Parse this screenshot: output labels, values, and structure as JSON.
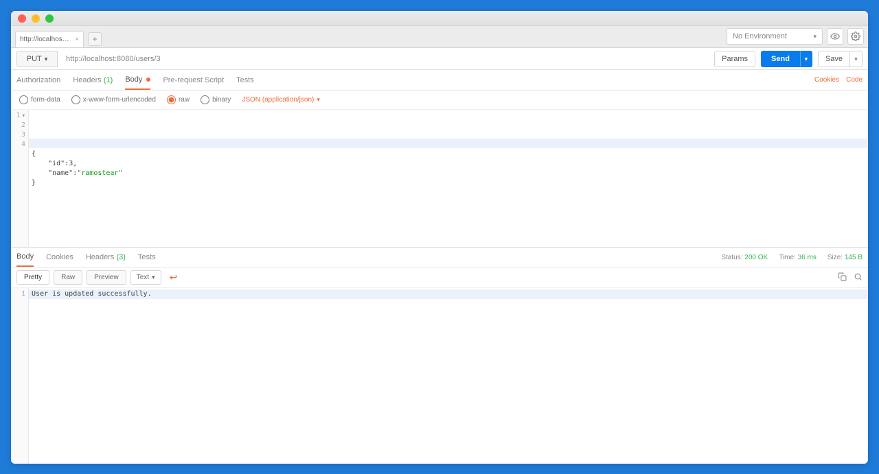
{
  "tabs": {
    "request_tab_label": "http://localhost:8080/"
  },
  "env": {
    "selected": "No Environment"
  },
  "request": {
    "method": "PUT",
    "url": "http://localhost:8080/users/3",
    "buttons": {
      "params": "Params",
      "send": "Send",
      "save": "Save"
    }
  },
  "request_tabs": {
    "authorization": "Authorization",
    "headers": "Headers",
    "headers_count": "(1)",
    "body": "Body",
    "prerequest": "Pre-request Script",
    "tests": "Tests",
    "cookies": "Cookies",
    "code": "Code"
  },
  "body_type": {
    "form_data": "form-data",
    "x_www": "x-www-form-urlencoded",
    "raw": "raw",
    "binary": "binary",
    "content_type": "JSON (application/json)"
  },
  "body_editor": {
    "line1": "{",
    "line2_pre": "    \"id\":",
    "line2_val": "3",
    "line2_post": ",",
    "line3_pre": "    \"name\":",
    "line3_val": "\"ramostear\"",
    "line4": "}"
  },
  "response_tabs": {
    "body": "Body",
    "cookies": "Cookies",
    "headers": "Headers",
    "headers_count": "(3)",
    "tests": "Tests"
  },
  "response_meta": {
    "status_lbl": "Status:",
    "status_val": "200 OK",
    "time_lbl": "Time:",
    "time_val": "36 ms",
    "size_lbl": "Size:",
    "size_val": "145 B"
  },
  "response_tool": {
    "pretty": "Pretty",
    "raw": "Raw",
    "preview": "Preview",
    "format": "Text"
  },
  "response_body": {
    "line1": "User is updated successfully."
  }
}
